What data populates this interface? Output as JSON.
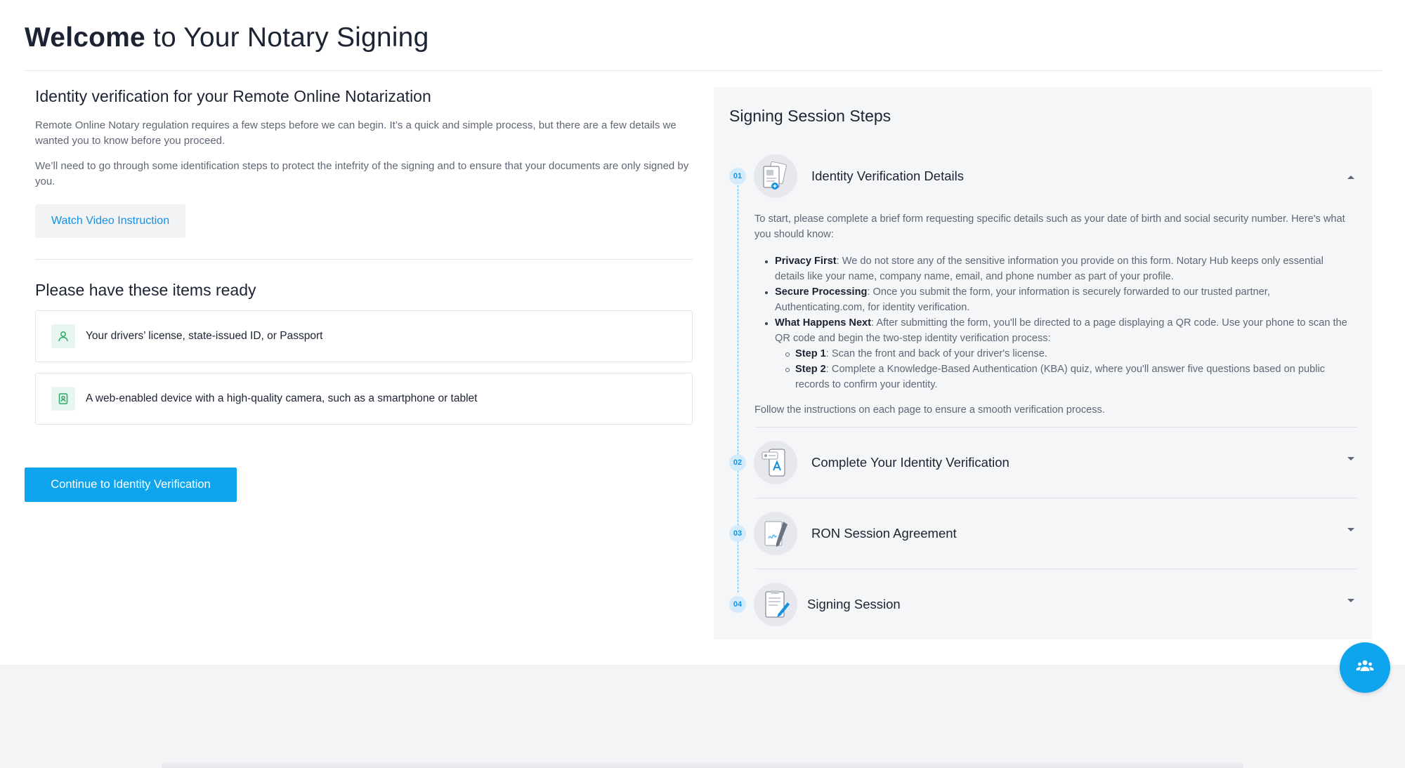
{
  "header": {
    "title_strong": "Welcome",
    "title_rest": " to Your Notary Signing"
  },
  "left": {
    "heading": "Identity verification for your Remote Online Notarization",
    "para1": "Remote Online Notary regulation requires a few steps before we can begin. It’s a quick and simple process, but there are a few details we wanted you to know before you proceed.",
    "para2": "We’ll need to go through some identification steps to protect the intefrity of the signing and to ensure that your documents are only signed by you.",
    "watch_video_label": "Watch Video Instruction",
    "items_heading": "Please have these items ready",
    "items": [
      {
        "label": "Your drivers’ license, state-issued ID, or Passport",
        "icon": "person-icon"
      },
      {
        "label": "A web-enabled device with a high-quality camera, such as a smartphone or tablet",
        "icon": "id-card-icon"
      }
    ],
    "continue_label": "Continue to Identity Verification"
  },
  "panel": {
    "title": "Signing Session Steps",
    "steps": [
      {
        "num": "01",
        "title": "Identity Verification Details",
        "expanded": true
      },
      {
        "num": "02",
        "title": "Complete Your Identity Verification",
        "expanded": false
      },
      {
        "num": "03",
        "title": "RON Session Agreement",
        "expanded": false
      },
      {
        "num": "04",
        "title": "Signing Session",
        "expanded": false
      }
    ],
    "step1_body": {
      "intro": "To start, please complete a brief form requesting specific details such as your date of birth and social security number. Here's what you should know:",
      "privacy_label": "Privacy First",
      "privacy_text": ": We do not store any of the sensitive information you provide on this form. Notary Hub keeps only essential details like your name, company name, email, and phone number as part of your profile.",
      "secure_label": "Secure Processing",
      "secure_text": ": Once you submit the form, your information is securely forwarded to our trusted partner, Authenticating.com, for identity verification.",
      "next_label": "What Happens Next",
      "next_text": ": After submitting the form, you'll be directed to a page displaying a QR code. Use your phone to scan the QR code and begin the two-step identity verification process:",
      "sub1_label": "Step 1",
      "sub1_text": ": Scan the front and back of your driver's license.",
      "sub2_label": "Step 2",
      "sub2_text": ": Complete a Knowledge-Based Authentication (KBA) quiz, where you'll answer five questions based on public records to confirm your identity.",
      "follow": "Follow the instructions on each page to ensure a smooth verification process."
    }
  },
  "colors": {
    "accent": "#0ea5ee",
    "link": "#1690e0",
    "success_tint": "#e7f6ee",
    "success": "#2fa866"
  }
}
